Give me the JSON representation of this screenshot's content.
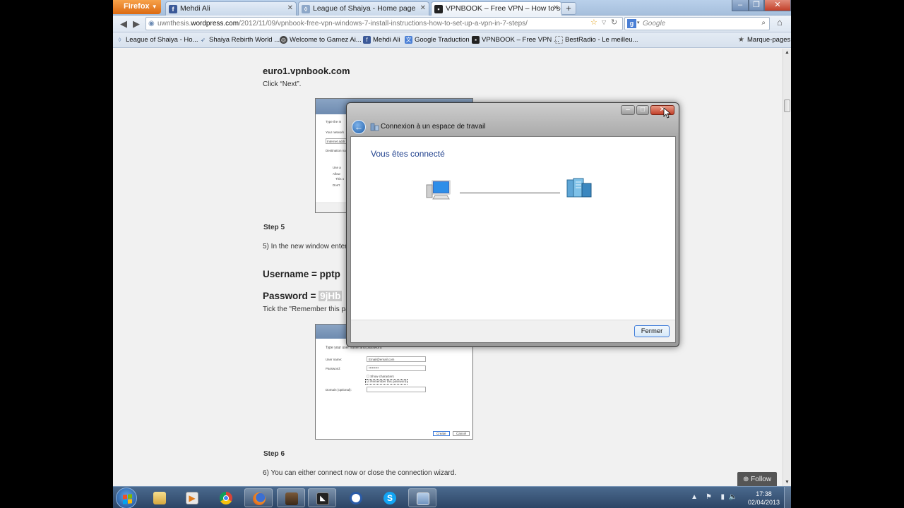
{
  "browser": {
    "app_button": "Firefox",
    "tabs": [
      {
        "title": "Mehdi Ali",
        "icon": "facebook-icon"
      },
      {
        "title": "League of Shaiya - Home page",
        "icon": "shaiya-icon"
      },
      {
        "title": "VPNBOOK – Free VPN – How to set u...",
        "icon": "vpnbook-icon"
      }
    ],
    "url_gray_prefix": "uwnthesis.",
    "url_domain": "wordpress.com",
    "url_rest": "/2012/11/09/vpnbook-free-vpn-windows-7-install-instructions-how-to-set-up-a-vpn-in-7-steps/",
    "search_placeholder": "Google",
    "bookmarks": [
      "League of Shaiya - Ho...",
      "Shaiya Rebirth World ...",
      "Welcome to Gamez Ai...",
      "Mehdi Ali",
      "Google Traduction",
      "VPNBOOK – Free VPN ...",
      "BestRadio - Le meilleu..."
    ],
    "bookmarks_menu": "Marque-pages"
  },
  "page": {
    "server": "euro1.vpnbook.com",
    "click_next": "Click “Next”.",
    "step5": "Step 5",
    "step5_text": "5) In the new window enter",
    "username": "Username = pptp",
    "password_label": "Password = ",
    "password_value": "9jHb",
    "tick_text": "Tick the \"Remember this pa",
    "step6": "Step 6",
    "step6_text": "6) You can either connect now or close the connection wizard.",
    "follow": "Follow",
    "shot2": {
      "title": "Type your user name and password",
      "user_label": "User name:",
      "user_value": "Email@email.com",
      "pass_label": "Password:",
      "pass_value": "•••••••••",
      "show_chars": "Show characters",
      "remember": "Remember this password",
      "domain_label": "Domain (optional):",
      "create": "Create",
      "cancel": "Cancel"
    },
    "shot1": {
      "line1": "Type the In",
      "line2": "Your network",
      "line3": "Internet addr",
      "line4": "Destination na",
      "line5": "Use a",
      "line6": "Allow",
      "line7": "This o",
      "line8": "Don't"
    }
  },
  "dialog": {
    "title": "Connexion à un espace de travail",
    "heading": "Vous êtes connecté",
    "close_button": "Fermer"
  },
  "taskbar": {
    "apps": [
      "explorer",
      "media-player",
      "chrome",
      "firefox",
      "game",
      "network-app",
      "ccleaner",
      "skype",
      "remote-desktop"
    ],
    "time": "17:38",
    "date": "02/04/2013"
  }
}
